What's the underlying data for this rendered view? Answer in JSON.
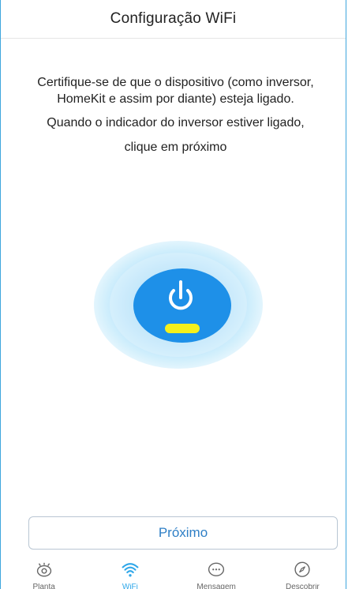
{
  "header": {
    "title": "Configuração WiFi"
  },
  "instructions": {
    "line1": "Certifique-se de que o dispositivo (como inversor,",
    "line2": "HomeKit e assim por diante) esteja ligado.",
    "line3": "Quando o indicador do inversor estiver ligado,",
    "line4": "clique em próximo"
  },
  "device": {
    "icon": "power-icon",
    "indicator_color": "#f5f01c",
    "core_color": "#1e90e8",
    "glow_color": "#bfe6fb"
  },
  "actions": {
    "next_label": "Próximo"
  },
  "tabbar": {
    "tabs": [
      {
        "label": "Planta",
        "icon": "eye-icon",
        "active": false
      },
      {
        "label": "WiFi",
        "icon": "wifi-icon",
        "active": true
      },
      {
        "label": "Mensagem",
        "icon": "message-icon",
        "active": false
      },
      {
        "label": "Descobrir",
        "icon": "compass-icon",
        "active": false
      }
    ]
  },
  "colors": {
    "accent": "#2fa7e9",
    "button_text": "#2e7fc6"
  }
}
